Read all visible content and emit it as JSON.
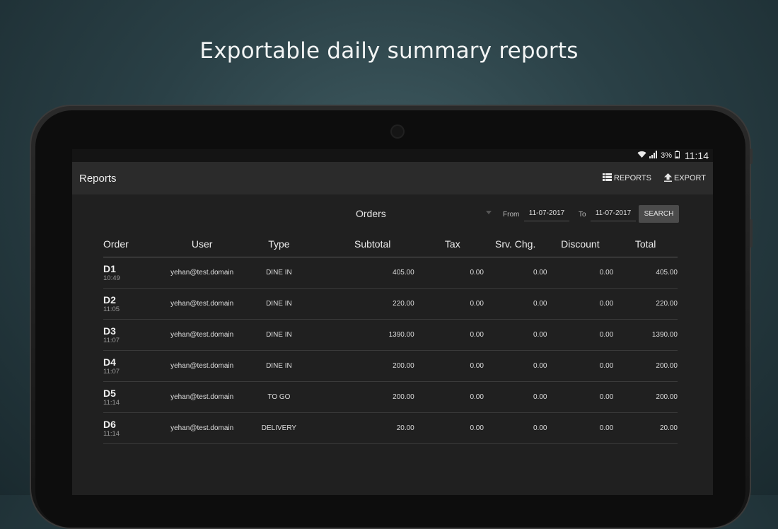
{
  "headline": "Exportable daily summary reports",
  "status_bar": {
    "battery": "3%",
    "time": "11:14"
  },
  "app_bar": {
    "title": "Reports",
    "reports_label": "REPORTS",
    "export_label": "EXPORT"
  },
  "filters": {
    "report_type": "Orders",
    "from_label": "From",
    "from_date": "11-07-2017",
    "to_label": "To",
    "to_date": "11-07-2017",
    "search_label": "SEARCH"
  },
  "table": {
    "headers": [
      "Order",
      "User",
      "Type",
      "Subtotal",
      "Tax",
      "Srv. Chg.",
      "Discount",
      "Total"
    ],
    "rows": [
      {
        "order": "D1",
        "time": "10:49",
        "user": "yehan@test.domain",
        "type": "DINE IN",
        "subtotal": "405.00",
        "tax": "0.00",
        "srv": "0.00",
        "discount": "0.00",
        "total": "405.00"
      },
      {
        "order": "D2",
        "time": "11:05",
        "user": "yehan@test.domain",
        "type": "DINE IN",
        "subtotal": "220.00",
        "tax": "0.00",
        "srv": "0.00",
        "discount": "0.00",
        "total": "220.00"
      },
      {
        "order": "D3",
        "time": "11:07",
        "user": "yehan@test.domain",
        "type": "DINE IN",
        "subtotal": "1390.00",
        "tax": "0.00",
        "srv": "0.00",
        "discount": "0.00",
        "total": "1390.00"
      },
      {
        "order": "D4",
        "time": "11:07",
        "user": "yehan@test.domain",
        "type": "DINE IN",
        "subtotal": "200.00",
        "tax": "0.00",
        "srv": "0.00",
        "discount": "0.00",
        "total": "200.00"
      },
      {
        "order": "D5",
        "time": "11:14",
        "user": "yehan@test.domain",
        "type": "TO GO",
        "subtotal": "200.00",
        "tax": "0.00",
        "srv": "0.00",
        "discount": "0.00",
        "total": "200.00"
      },
      {
        "order": "D6",
        "time": "11:14",
        "user": "yehan@test.domain",
        "type": "DELIVERY",
        "subtotal": "20.00",
        "tax": "0.00",
        "srv": "0.00",
        "discount": "0.00",
        "total": "20.00"
      }
    ]
  }
}
